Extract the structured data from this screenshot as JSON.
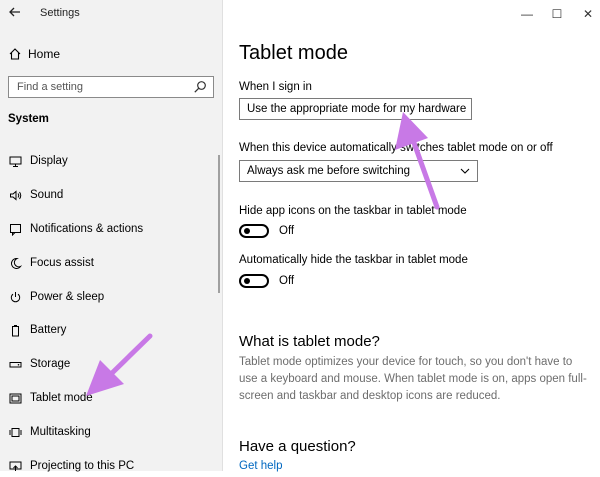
{
  "window": {
    "title": "Settings",
    "controls": {
      "minimize": "—",
      "maximize": "☐",
      "close": "✕"
    }
  },
  "sidebar": {
    "home_label": "Home",
    "search": {
      "placeholder": "Find a setting"
    },
    "section": "System",
    "items": [
      {
        "label": "Display",
        "icon": "display-icon"
      },
      {
        "label": "Sound",
        "icon": "sound-icon"
      },
      {
        "label": "Notifications & actions",
        "icon": "notifications-icon"
      },
      {
        "label": "Focus assist",
        "icon": "moon-icon"
      },
      {
        "label": "Power & sleep",
        "icon": "power-icon"
      },
      {
        "label": "Battery",
        "icon": "battery-icon"
      },
      {
        "label": "Storage",
        "icon": "storage-icon"
      },
      {
        "label": "Tablet mode",
        "icon": "tablet-icon"
      },
      {
        "label": "Multitasking",
        "icon": "multitasking-icon"
      },
      {
        "label": "Projecting to this PC",
        "icon": "projecting-icon"
      }
    ]
  },
  "main": {
    "title": "Tablet mode",
    "sign_in": {
      "label": "When I sign in",
      "value": "Use the appropriate mode for my hardware"
    },
    "auto_switch": {
      "label": "When this device automatically switches tablet mode on or off",
      "value": "Always ask me before switching"
    },
    "hide_icons": {
      "label": "Hide app icons on the taskbar in tablet mode",
      "state": "Off"
    },
    "hide_taskbar": {
      "label": "Automatically hide the taskbar in tablet mode",
      "state": "Off"
    },
    "what_is": {
      "heading": "What is tablet mode?",
      "text": "Tablet mode optimizes your device for touch, so you don't have to use a keyboard and mouse. When tablet mode is on, apps open full-screen and taskbar and desktop icons are reduced."
    },
    "question": {
      "heading": "Have a question?",
      "link": "Get help"
    }
  },
  "annotation": {
    "color": "#c879e6"
  }
}
